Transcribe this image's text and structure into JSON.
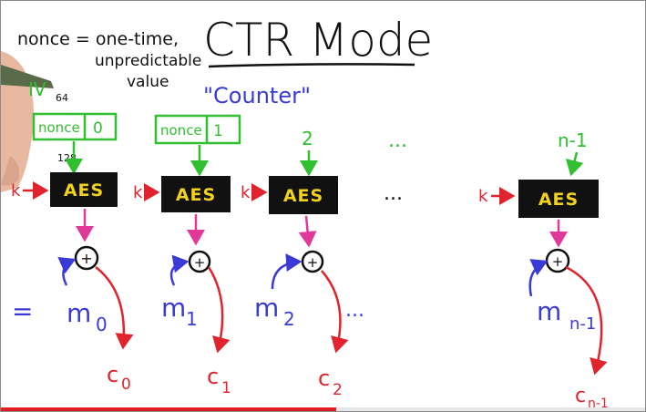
{
  "title": "CTR Mode",
  "nonce_definition": {
    "line1": "nonce = one-time,",
    "line2": "unpredictable",
    "line3": "value"
  },
  "counter_label": "\"Counter\"",
  "iv_label": "IV",
  "bits_64": "64",
  "bits_128": "128",
  "key_label": "k",
  "block_cipher": "AES",
  "xor_symbol": "+",
  "equals_sign": "=",
  "ellipsis": "...",
  "inputs": [
    {
      "nonce": "nonce",
      "counter": "0"
    },
    {
      "nonce": "nonce",
      "counter": "1"
    },
    {
      "counter": "2"
    },
    {
      "counter": "n-1"
    }
  ],
  "messages": [
    {
      "m": "m",
      "sub": "0"
    },
    {
      "m": "m",
      "sub": "1"
    },
    {
      "m": "m",
      "sub": "2"
    },
    {
      "m": "m",
      "sub": "n-1"
    }
  ],
  "ciphertexts": [
    {
      "c": "c",
      "sub": "0"
    },
    {
      "c": "c",
      "sub": "1"
    },
    {
      "c": "c",
      "sub": "2"
    },
    {
      "c": "c",
      "sub": "n-1"
    }
  ],
  "video_progress": 0.52,
  "colors": {
    "ink": "#111111",
    "green": "#2fbf2f",
    "red": "#e0232c",
    "pink": "#e0399a",
    "blue": "#3a3ad6",
    "aes_box": "#111111",
    "aes_text": "#f2d21c"
  }
}
